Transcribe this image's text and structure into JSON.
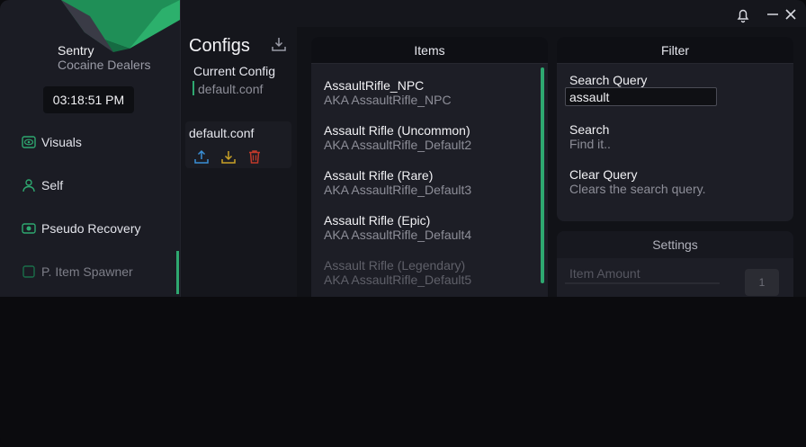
{
  "app": {
    "name": "Sentry",
    "subtitle": "Cocaine Dealers",
    "clock": "03:18:51 PM"
  },
  "sidebar": {
    "items": [
      {
        "label": "Visuals",
        "icon": "eye-icon"
      },
      {
        "label": "Self",
        "icon": "user-icon"
      },
      {
        "label": "Pseudo Recovery",
        "icon": "recovery-icon"
      },
      {
        "label": "P. Item Spawner",
        "icon": "spawner-icon"
      }
    ]
  },
  "configs": {
    "title": "Configs",
    "current_label": "Current Config",
    "current_value": "default.conf",
    "entries": [
      {
        "name": "default.conf"
      }
    ]
  },
  "items_panel": {
    "header": "Items",
    "items": [
      {
        "title": "AssaultRifle_NPC",
        "aka": "AKA AssaultRifle_NPC"
      },
      {
        "title": "Assault Rifle (Uncommon)",
        "aka": "AKA AssaultRifle_Default2"
      },
      {
        "title": "Assault Rifle (Rare)",
        "aka": "AKA AssaultRifle_Default3"
      },
      {
        "title": "Assault Rifle (Epic)",
        "aka": "AKA AssaultRifle_Default4"
      },
      {
        "title": "Assault Rifle (Legendary)",
        "aka": "AKA AssaultRifle_Default5"
      }
    ]
  },
  "filter_panel": {
    "header": "Filter",
    "search_label": "Search Query",
    "search_value": "assault",
    "search_button": {
      "title": "Search",
      "sub": "Find it.."
    },
    "clear_button": {
      "title": "Clear Query",
      "sub": "Clears the search query."
    }
  },
  "settings_panel": {
    "header": "Settings",
    "amount_label": "Item Amount",
    "amount_value": "1"
  },
  "colors": {
    "accent": "#2ea870",
    "delete": "#c0392b",
    "export": "#3a8fd6",
    "import": "#c9a227"
  }
}
